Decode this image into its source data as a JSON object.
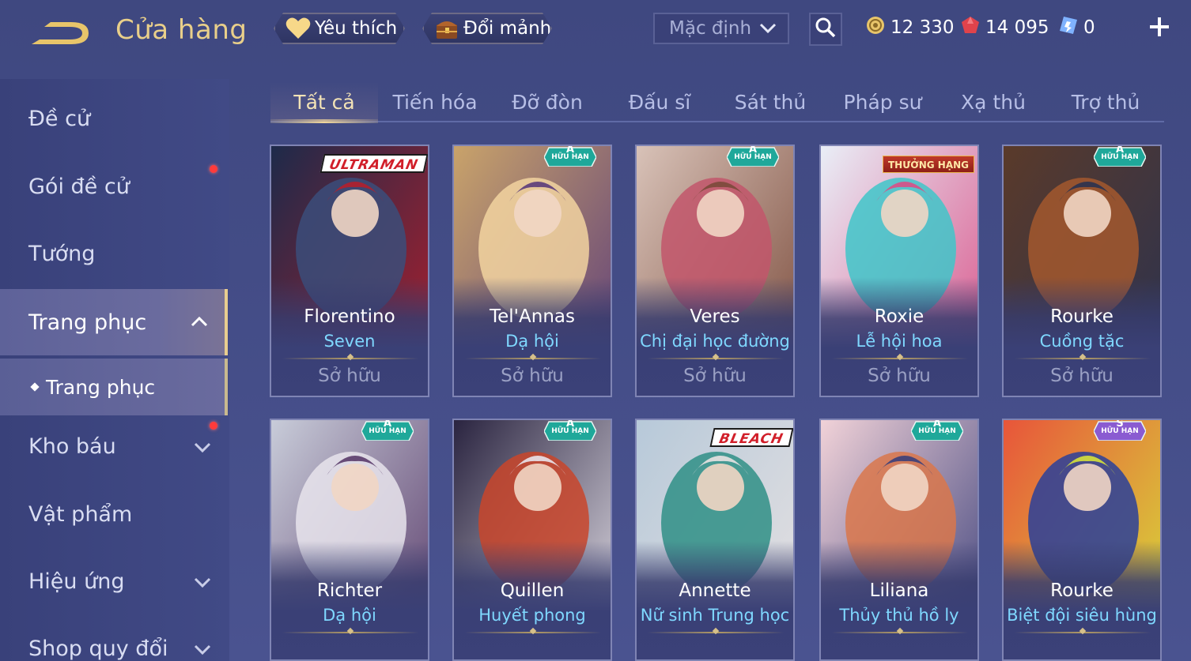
{
  "header": {
    "title": "Cửa hàng",
    "favorites_label": "Yêu thích",
    "fragments_label": "Đổi mảnh",
    "sort_selected": "Mặc định",
    "currencies": [
      {
        "name": "gold-coin",
        "amount": "12 330",
        "color": "#e8c56a"
      },
      {
        "name": "ruby",
        "amount": "14 095",
        "color": "#e0434b"
      },
      {
        "name": "voucher",
        "amount": "0",
        "color": "#7fb2ff"
      }
    ]
  },
  "sidebar": {
    "items": [
      {
        "label": "Đề cử"
      },
      {
        "label": "Gói đề cử"
      },
      {
        "label": "Tướng"
      },
      {
        "label": "Trang phục"
      },
      {
        "label": "Kho báu"
      },
      {
        "label": "Vật phẩm"
      },
      {
        "label": "Hiệu ứng"
      },
      {
        "label": "Shop quy đổi"
      }
    ],
    "sub_item": {
      "label": "Trang phục"
    }
  },
  "tabs": [
    {
      "label": "Tất cả"
    },
    {
      "label": "Tiến hóa"
    },
    {
      "label": "Đỡ đòn"
    },
    {
      "label": "Đấu sĩ"
    },
    {
      "label": "Sát thủ"
    },
    {
      "label": "Pháp sư"
    },
    {
      "label": "Xạ thủ"
    },
    {
      "label": "Trợ thủ"
    }
  ],
  "cards": [
    {
      "hero": "Florentino",
      "skin": "Seven",
      "status": "Sở hữu",
      "badge_rank": "",
      "badge_label": "",
      "tag": "ULTRAMAN",
      "tag_style": "logo",
      "palette": [
        "#1d2a4a",
        "#3b4d7a",
        "#b21f2c"
      ]
    },
    {
      "hero": "Tel'Annas",
      "skin": "Dạ hội",
      "status": "Sở hữu",
      "badge_rank": "A",
      "badge_label": "HỮU HẠN",
      "tag": "",
      "tag_style": "",
      "palette": [
        "#c9a36a",
        "#f2d3a0",
        "#5b3b7a"
      ]
    },
    {
      "hero": "Veres",
      "skin": "Chị đại học đường",
      "status": "Sở hữu",
      "badge_rank": "A",
      "badge_label": "HỮU HẠN",
      "tag": "",
      "tag_style": "",
      "palette": [
        "#d8c2b8",
        "#c2566b",
        "#7a4a3a"
      ]
    },
    {
      "hero": "Roxie",
      "skin": "Lễ hội hoa",
      "status": "Sở hữu",
      "badge_rank": "",
      "badge_label": "",
      "tag": "THƯỞNG HẠNG",
      "tag_style": "ribbon",
      "palette": [
        "#e9eef7",
        "#3fc6c9",
        "#d94f86"
      ]
    },
    {
      "hero": "Rourke",
      "skin": "Cuồng tặc",
      "status": "Sở hữu",
      "badge_rank": "A",
      "badge_label": "HỮU HẠN",
      "tag": "",
      "tag_style": "",
      "palette": [
        "#5a3a2a",
        "#a3582e",
        "#2a3250"
      ]
    },
    {
      "hero": "Richter",
      "skin": "Dạ hội",
      "status": "",
      "badge_rank": "A",
      "badge_label": "HỮU HẠN",
      "tag": "",
      "tag_style": "",
      "palette": [
        "#c8ccd9",
        "#e8e4ec",
        "#5a3b6a"
      ]
    },
    {
      "hero": "Quillen",
      "skin": "Huyết phong",
      "status": "",
      "badge_rank": "A",
      "badge_label": "HỮU HẠN",
      "tag": "",
      "tag_style": "",
      "palette": [
        "#2a2440",
        "#c9452a",
        "#e8e4ec"
      ]
    },
    {
      "hero": "Annette",
      "skin": "Nữ sinh Trung học",
      "status": "",
      "badge_rank": "",
      "badge_label": "",
      "tag": "BLEACH",
      "tag_style": "logo",
      "palette": [
        "#b7c9d9",
        "#2f8f86",
        "#e8e2e2"
      ]
    },
    {
      "hero": "Liliana",
      "skin": "Thủy thủ hồ ly",
      "status": "",
      "badge_rank": "A",
      "badge_label": "HỮU HẠN",
      "tag": "",
      "tag_style": "",
      "palette": [
        "#f1d2d8",
        "#d9774b",
        "#3a3f7a"
      ]
    },
    {
      "hero": "Rourke",
      "skin": "Biệt đội siêu hùng",
      "status": "",
      "badge_rank": "S",
      "badge_label": "HỮU HẠN",
      "tag": "",
      "tag_style": "",
      "palette": [
        "#e8553a",
        "#2a3f9a",
        "#d6e23a"
      ]
    }
  ]
}
